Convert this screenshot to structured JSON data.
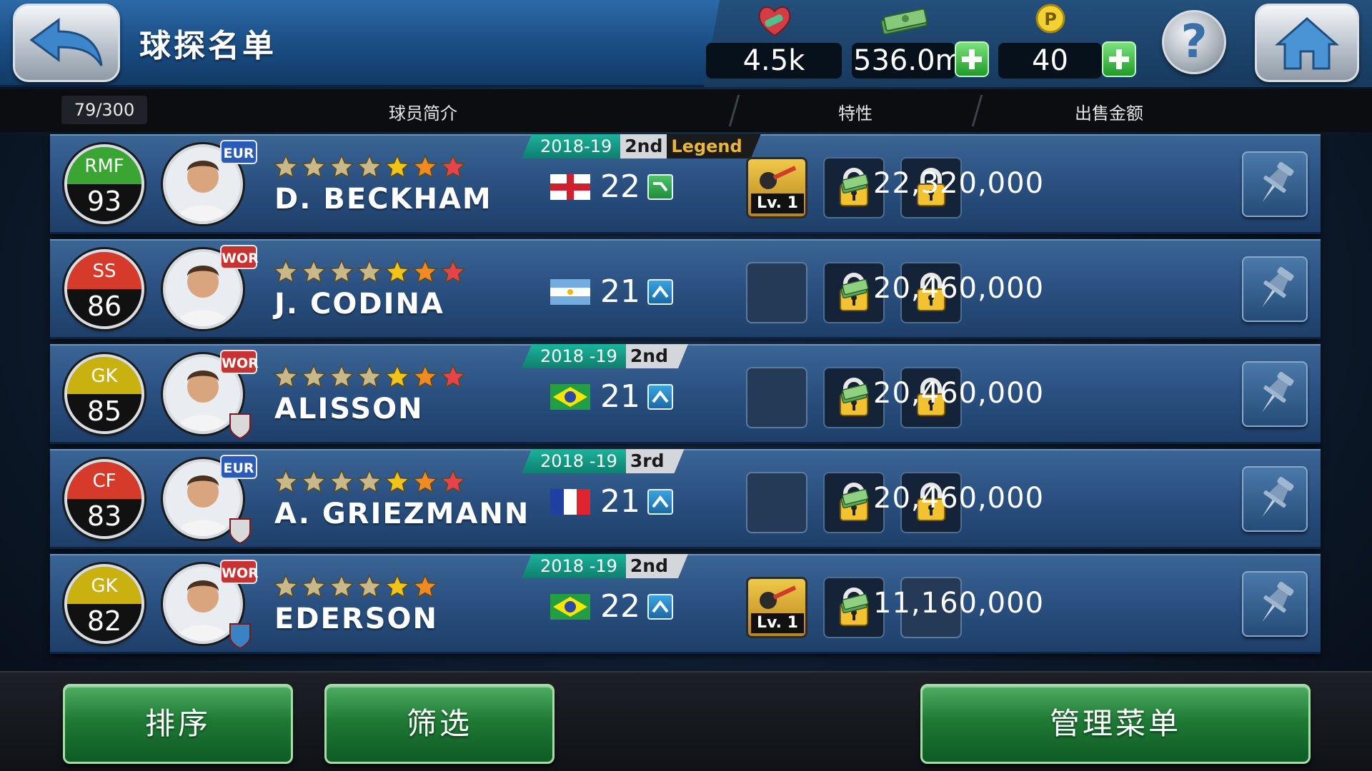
{
  "header": {
    "title": "球探名单",
    "stats": {
      "gp": "4.5k",
      "money": "536.0m",
      "coins": "40"
    }
  },
  "columns": {
    "count": "79/300",
    "profile": "球员简介",
    "traits": "特性",
    "sale_price": "出售金额"
  },
  "players": [
    {
      "position": "RMF",
      "rating": "93",
      "badge_color": "#3aa533",
      "region": "EUR",
      "name": "D. BECKHAM",
      "stars": 7,
      "season": "2018-19",
      "tier": "2nd",
      "legend": "Legend",
      "nationality": "England",
      "age": "22",
      "condition": "green",
      "skills": [
        "active",
        "locked",
        "locked"
      ],
      "skill_level": "Lv. 1",
      "price": "22,320,000"
    },
    {
      "position": "SS",
      "rating": "86",
      "badge_color": "#d63a2a",
      "region": "WOR",
      "name": "J. CODINA",
      "stars": 7,
      "season": "",
      "tier": "",
      "legend": "",
      "nationality": "Argentina",
      "age": "21",
      "condition": "blue",
      "skills": [
        "empty",
        "locked",
        "locked"
      ],
      "skill_level": "",
      "price": "20,460,000"
    },
    {
      "position": "GK",
      "rating": "85",
      "badge_color": "#c9b20f",
      "region": "WOR",
      "name": "ALISSON",
      "stars": 7,
      "season": "2018 -19",
      "tier": "2nd",
      "legend": "",
      "nationality": "Brazil",
      "age": "21",
      "condition": "blue",
      "skills": [
        "empty",
        "locked",
        "locked"
      ],
      "skill_level": "",
      "price": "20,460,000"
    },
    {
      "position": "CF",
      "rating": "83",
      "badge_color": "#d63a2a",
      "region": "EUR",
      "name": "A. GRIEZMANN",
      "stars": 7,
      "season": "2018 -19",
      "tier": "3rd",
      "legend": "",
      "nationality": "France",
      "age": "21",
      "condition": "blue",
      "skills": [
        "empty",
        "locked",
        "locked"
      ],
      "skill_level": "",
      "price": "20,460,000"
    },
    {
      "position": "GK",
      "rating": "82",
      "badge_color": "#c9b20f",
      "region": "WOR",
      "name": "EDERSON",
      "stars": 6,
      "season": "2018 -19",
      "tier": "2nd",
      "legend": "",
      "nationality": "Brazil",
      "age": "22",
      "condition": "blue",
      "skills": [
        "active",
        "locked",
        "empty"
      ],
      "skill_level": "Lv. 1",
      "price": "11,160,000"
    }
  ],
  "footer": {
    "sort": "排序",
    "filter": "筛选",
    "manage": "管理菜单"
  },
  "icons": {
    "back": "back-arrow-icon",
    "gp": "handshake-icon",
    "money": "cash-icon",
    "coins": "coin-icon",
    "add": "plus-icon",
    "help": "question-icon",
    "home": "home-icon",
    "lock": "lock-icon",
    "pin": "pin-icon"
  }
}
